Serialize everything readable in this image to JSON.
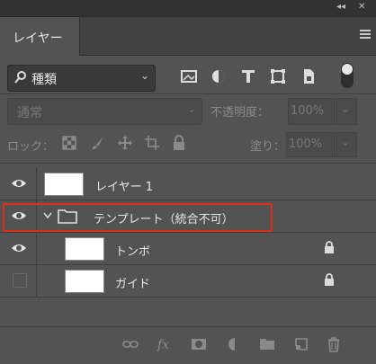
{
  "window": {
    "collapse_glyph": "◂◂",
    "close_glyph": "✕"
  },
  "tab": {
    "label": "レイヤー"
  },
  "filter": {
    "label": "種類",
    "chevron": "⌄"
  },
  "filter_icons": [
    "image-filter-icon",
    "adjustment-filter-icon",
    "type-filter-icon",
    "shape-filter-icon",
    "smart-object-filter-icon"
  ],
  "blend": {
    "mode": "通常",
    "opacity_label": "不透明度：",
    "opacity_value": "100%"
  },
  "lock": {
    "label": "ロック：",
    "fill_label": "塗り：",
    "fill_value": "100%"
  },
  "layers": [
    {
      "name": "レイヤー 1",
      "visible": true,
      "locked": false
    },
    {
      "name": "テンプレート（統合不可）",
      "visible": true,
      "is_group": true
    },
    {
      "name": "トンボ",
      "visible": true,
      "locked": true
    },
    {
      "name": "ガイド",
      "visible": false,
      "locked": true
    }
  ],
  "colors": {
    "highlight": "#e02d16",
    "panel": "#535353"
  }
}
